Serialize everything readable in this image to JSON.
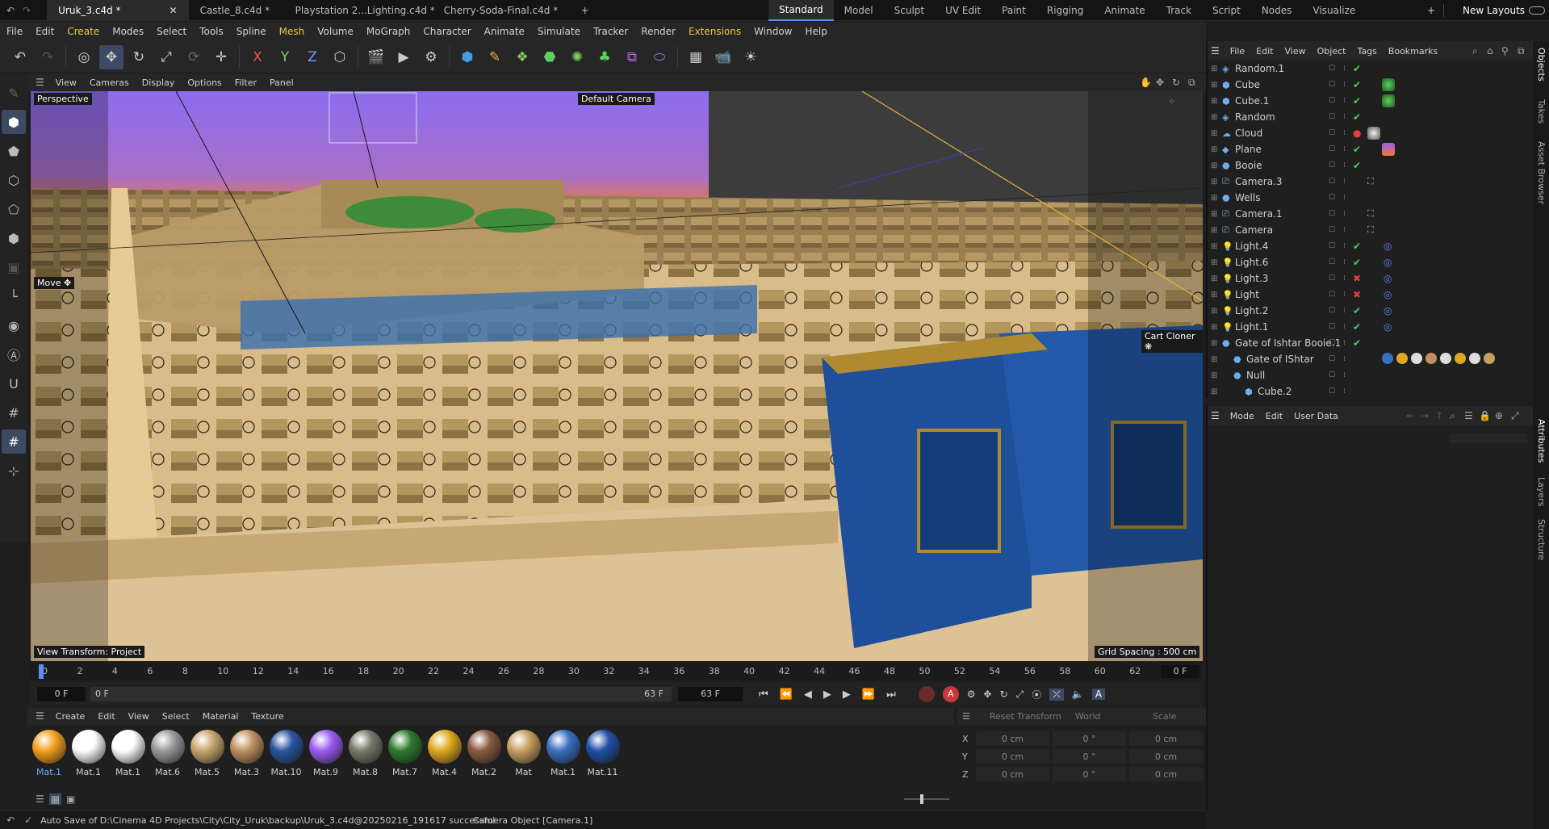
{
  "tabs": [
    {
      "label": "Uruk_3.c4d *",
      "active": true
    },
    {
      "label": "Castle_8.c4d *"
    },
    {
      "label": "Playstation 2...Lighting.c4d *"
    },
    {
      "label": "Cherry-Soda-Final.c4d *"
    }
  ],
  "layouts": [
    "Standard",
    "Model",
    "Sculpt",
    "UV Edit",
    "Paint",
    "Rigging",
    "Animate",
    "Track",
    "Script",
    "Nodes",
    "Visualize"
  ],
  "new_layouts": "New Layouts",
  "menu": [
    "File",
    "Edit",
    "Create",
    "Modes",
    "Select",
    "Tools",
    "Spline",
    "Mesh",
    "Volume",
    "MoGraph",
    "Character",
    "Animate",
    "Simulate",
    "Tracker",
    "Render",
    "Extensions",
    "Window",
    "Help"
  ],
  "viewport_menu": [
    "View",
    "Cameras",
    "Display",
    "Options",
    "Filter",
    "Panel"
  ],
  "viewport": {
    "mode": "Perspective",
    "camera": "Default Camera",
    "tool": "Move",
    "view_transform": "View Transform: Project",
    "grid_spacing": "Grid Spacing : 500 cm",
    "cloner_label": "Cart Cloner"
  },
  "objects_menu": [
    "File",
    "Edit",
    "View",
    "Object",
    "Tags",
    "Bookmarks"
  ],
  "objects": [
    {
      "name": "Random.1",
      "status": "check"
    },
    {
      "name": "Cube",
      "status": "check"
    },
    {
      "name": "Cube.1",
      "status": "check"
    },
    {
      "name": "Random",
      "status": "check"
    },
    {
      "name": "Cloud",
      "status": "dot"
    },
    {
      "name": "Plane",
      "status": "check"
    },
    {
      "name": "Booie",
      "status": "check"
    },
    {
      "name": "Camera.3",
      "status": ""
    },
    {
      "name": "Wells",
      "status": ""
    },
    {
      "name": "Camera.1",
      "status": ""
    },
    {
      "name": "Camera",
      "status": ""
    },
    {
      "name": "Light.4",
      "status": "check"
    },
    {
      "name": "Light.6",
      "status": "check"
    },
    {
      "name": "Light.3",
      "status": "x"
    },
    {
      "name": "Light",
      "status": "x"
    },
    {
      "name": "Light.2",
      "status": "check"
    },
    {
      "name": "Light.1",
      "status": "check"
    },
    {
      "name": "Gate of Ishtar Booie.1",
      "status": "check"
    },
    {
      "name": "Gate of IShtar",
      "status": ""
    },
    {
      "name": "Null",
      "status": ""
    },
    {
      "name": "Cube.2",
      "status": ""
    }
  ],
  "attributes_menu": [
    "Mode",
    "Edit",
    "User Data"
  ],
  "right_tabs": [
    "Objects",
    "Takes",
    "Asset Browser",
    "Attributes",
    "Layers",
    "Structure"
  ],
  "timeline": {
    "ticks": [
      "0",
      "2",
      "4",
      "6",
      "8",
      "10",
      "12",
      "14",
      "16",
      "18",
      "20",
      "22",
      "24",
      "26",
      "28",
      "30",
      "32",
      "34",
      "36",
      "38",
      "40",
      "42",
      "44",
      "46",
      "48",
      "50",
      "52",
      "54",
      "56",
      "58",
      "60",
      "62"
    ],
    "current": "0 F",
    "start": "0 F",
    "range_start": "0 F",
    "range_end": "63 F",
    "end": "63 F"
  },
  "material_menu": [
    "Create",
    "Edit",
    "View",
    "Select",
    "Material",
    "Texture"
  ],
  "materials": [
    {
      "name": "Mat.1",
      "color": "#f5a020"
    },
    {
      "name": "Mat.1",
      "color": "#ffffff"
    },
    {
      "name": "Mat.1",
      "color": "#ffffff"
    },
    {
      "name": "Mat.6",
      "color": "#9a9a9a"
    },
    {
      "name": "Mat.5",
      "color": "#c9a56e"
    },
    {
      "name": "Mat.3",
      "color": "#c09060"
    },
    {
      "name": "Mat.10",
      "color": "#2a55a0"
    },
    {
      "name": "Mat.9",
      "color": "#9b5cf0"
    },
    {
      "name": "Mat.8",
      "color": "#7a7a6a"
    },
    {
      "name": "Mat.7",
      "color": "#2f7a2f"
    },
    {
      "name": "Mat.4",
      "color": "#e0a820"
    },
    {
      "name": "Mat.2",
      "color": "#8a5a40"
    },
    {
      "name": "Mat",
      "color": "#c7a060"
    },
    {
      "name": "Mat.1",
      "color": "#3a70c0"
    },
    {
      "name": "Mat.11",
      "color": "#2050a8"
    }
  ],
  "coords": {
    "reset": "Reset Transform",
    "space": "World",
    "scale": "Scale",
    "rows": [
      {
        "axis": "X",
        "v1": "0 cm",
        "v2": "0 °",
        "v3": "0 cm"
      },
      {
        "axis": "Y",
        "v1": "0 cm",
        "v2": "0 °",
        "v3": "0 cm"
      },
      {
        "axis": "Z",
        "v1": "0 cm",
        "v2": "0 °",
        "v3": "0 cm"
      }
    ]
  },
  "status": {
    "message": "Auto Save of D:\\Cinema 4D Projects\\City\\City_Uruk\\backup\\Uruk_3.c4d@20250216_191617 successful",
    "selection": "Camera Object [Camera.1]"
  }
}
